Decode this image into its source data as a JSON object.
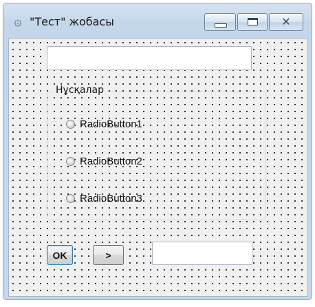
{
  "window": {
    "title": "\"Тест\" жобасы",
    "icon": "app-logo-icon",
    "controls": [
      "minimize-icon",
      "maximize-icon",
      "close-icon"
    ]
  },
  "form": {
    "top_edit": {
      "value": ""
    },
    "group": {
      "title": "Нұсқалар",
      "options": [
        {
          "label": "RadioButton1",
          "checked": false
        },
        {
          "label": "RadioButton2",
          "checked": false
        },
        {
          "label": "RadioButton3",
          "checked": false
        }
      ]
    },
    "ok_button": "OK",
    "next_button": ">",
    "bottom_edit": {
      "value": ""
    }
  },
  "colors": {
    "frame": "#c3d6ea",
    "client": "#f0f0f0",
    "grid_dot": "#222222"
  }
}
